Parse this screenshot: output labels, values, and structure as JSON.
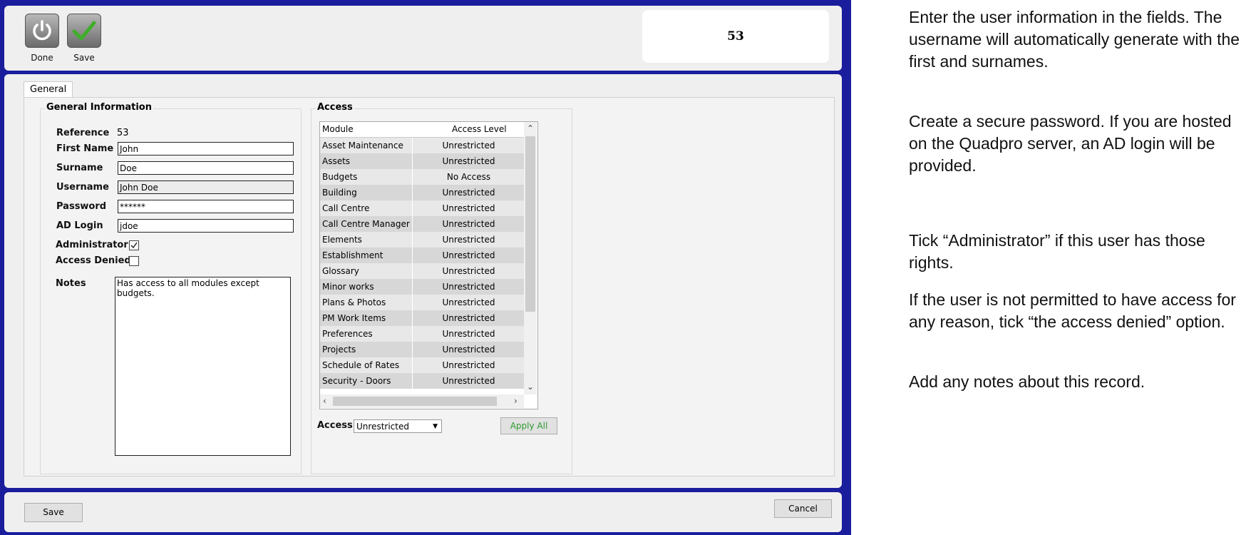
{
  "toolbar": {
    "done_label": "Done",
    "save_label": "Save",
    "record_number": "53"
  },
  "tabs": [
    {
      "label": "General"
    }
  ],
  "general": {
    "title": "General Information",
    "reference_label": "Reference",
    "reference_value": "53",
    "first_name_label": "First Name",
    "first_name_value": "John",
    "surname_label": "Surname",
    "surname_value": "Doe",
    "username_label": "Username",
    "username_value": "John Doe",
    "password_label": "Password",
    "password_value": "******",
    "ad_login_label": "AD Login",
    "ad_login_value": "jdoe",
    "administrator_label": "Administrator",
    "administrator_checked": true,
    "access_denied_label": "Access Denied",
    "access_denied_checked": false,
    "notes_label": "Notes",
    "notes_value": "Has access to all modules except\nbudgets."
  },
  "access": {
    "title": "Access",
    "columns": [
      "Module",
      "Access Level"
    ],
    "rows": [
      {
        "module": "Asset Maintenance",
        "level": "Unrestricted"
      },
      {
        "module": "Assets",
        "level": "Unrestricted"
      },
      {
        "module": "Budgets",
        "level": "No Access"
      },
      {
        "module": "Building",
        "level": "Unrestricted"
      },
      {
        "module": "Call Centre",
        "level": "Unrestricted"
      },
      {
        "module": "Call Centre Manager",
        "level": "Unrestricted"
      },
      {
        "module": "Elements",
        "level": "Unrestricted"
      },
      {
        "module": "Establishment",
        "level": "Unrestricted"
      },
      {
        "module": "Glossary",
        "level": "Unrestricted"
      },
      {
        "module": "Minor works",
        "level": "Unrestricted"
      },
      {
        "module": "Plans & Photos",
        "level": "Unrestricted"
      },
      {
        "module": "PM Work Items",
        "level": "Unrestricted"
      },
      {
        "module": "Preferences",
        "level": "Unrestricted"
      },
      {
        "module": "Projects",
        "level": "Unrestricted"
      },
      {
        "module": "Schedule of Rates",
        "level": "Unrestricted"
      },
      {
        "module": "Security - Doors",
        "level": "Unrestricted"
      }
    ],
    "access_label": "Access",
    "access_select_value": "Unrestricted",
    "apply_all_label": "Apply All"
  },
  "footer": {
    "save_label": "Save",
    "cancel_label": "Cancel"
  },
  "help": [
    "Enter the user information in the fields. The username will automatically generate with  the first and surnames.",
    "Create a secure password. If you are hosted on the Quadpro server, an AD login will be provided.",
    "Tick “Administrator” if this user has those rights.",
    "If the user is not permitted to have access for any reason, tick “the access denied” option.",
    "Add any notes about this record."
  ],
  "colors": {
    "frame": "#1a1d9c",
    "panel": "#efefef",
    "apply_all_text": "#2e9a2e",
    "save_check": "#3fae2a"
  },
  "icons": [
    "power-icon",
    "checkmark-icon",
    "checkbox-check-icon",
    "dropdown-arrow-icon",
    "scroll-up-icon",
    "scroll-down-icon",
    "scroll-left-icon",
    "scroll-right-icon"
  ]
}
